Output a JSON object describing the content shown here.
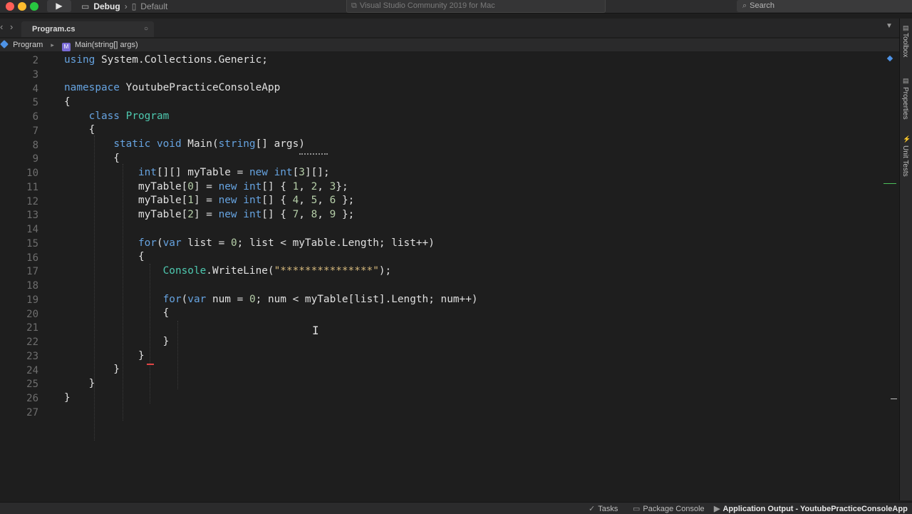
{
  "toolbar": {
    "run_icon": "play-icon",
    "config_label": "Debug",
    "config_sep": "›",
    "target_label": "Default",
    "status_text": "Visual Studio Community 2019 for Mac",
    "search_placeholder": "Search"
  },
  "tabs": [
    {
      "label": "Program.cs",
      "close": "○"
    }
  ],
  "breadcrumb": {
    "item1": "Program",
    "sep": "▸",
    "item2": "Main(string[] args)"
  },
  "editor": {
    "line_numbers": [
      "2",
      "3",
      "4",
      "5",
      "6",
      "7",
      "8",
      "9",
      "10",
      "11",
      "12",
      "13",
      "14",
      "15",
      "16",
      "17",
      "18",
      "19",
      "20",
      "21",
      "22",
      "23",
      "24",
      "25",
      "26",
      "27"
    ]
  },
  "right_dock": {
    "toolbox": "Toolbox",
    "properties": "Properties",
    "unit_tests": "Unit Tests"
  },
  "bottom_bar": {
    "tasks": "Tasks",
    "package_console": "Package Console",
    "app_output": "Application Output - YoutubePracticeConsoleApp"
  }
}
